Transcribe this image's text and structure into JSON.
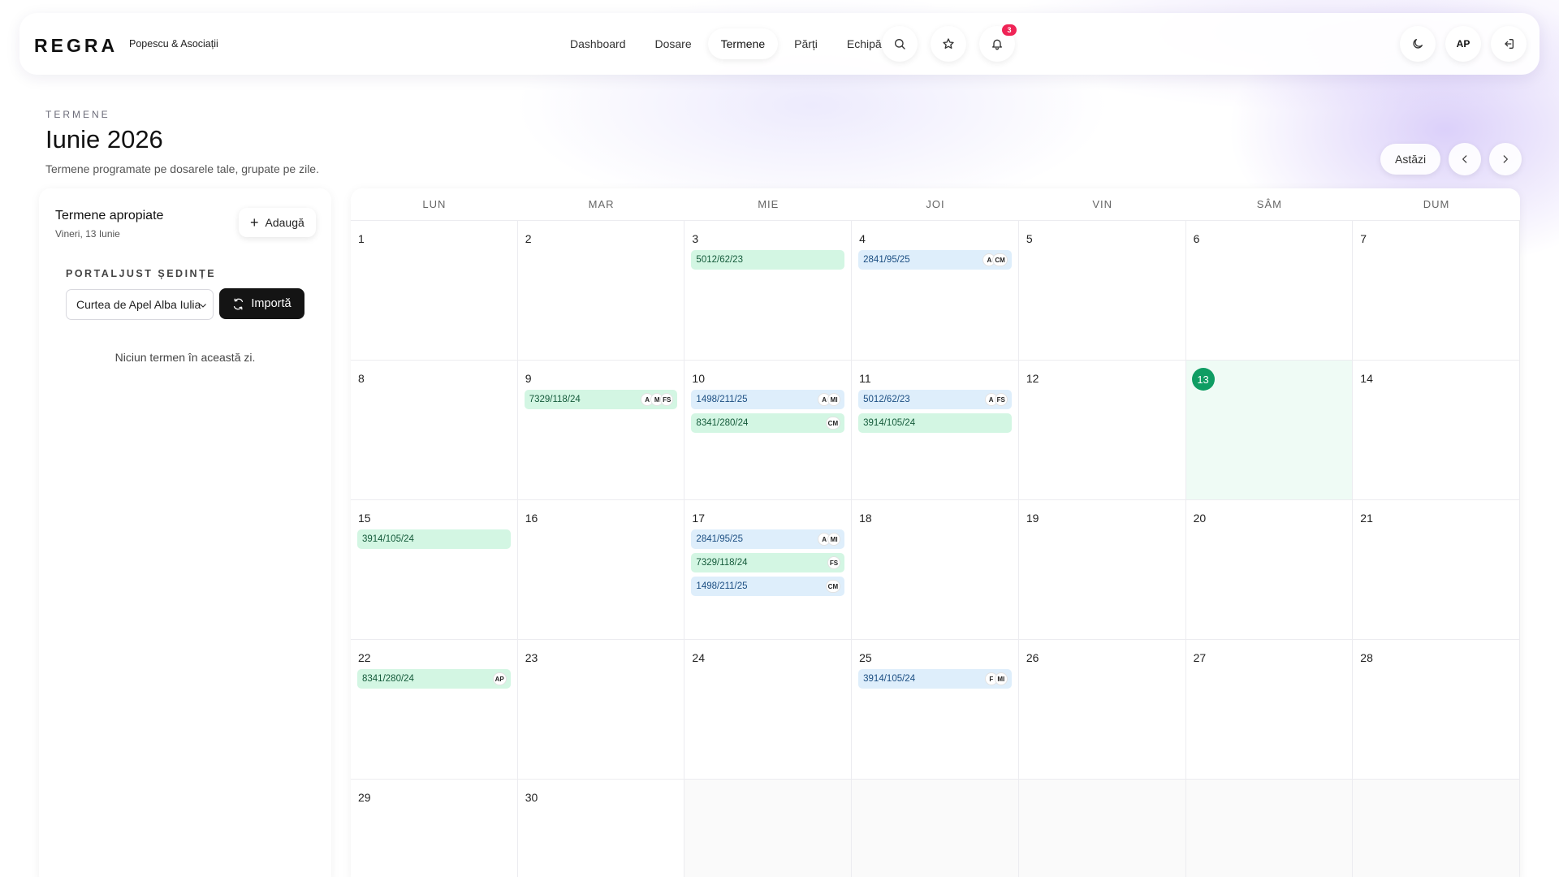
{
  "brand": {
    "logo": "REGRA",
    "firm": "Popescu & Asociații"
  },
  "nav": {
    "items": [
      {
        "label": "Dashboard",
        "active": false
      },
      {
        "label": "Dosare",
        "active": false
      },
      {
        "label": "Termene",
        "active": true
      },
      {
        "label": "Părți",
        "active": false
      },
      {
        "label": "Echipă",
        "active": false
      }
    ],
    "notifications_count": "3",
    "user_initials": "AP"
  },
  "header": {
    "eyebrow": "TERMENE",
    "title": "Iunie 2026",
    "subtitle": "Termene programate pe dosarele tale, grupate pe zile."
  },
  "controls": {
    "today_label": "Astăzi"
  },
  "side": {
    "title": "Termene apropiate",
    "date": "Vineri, 13 Iunie",
    "add_label": "Adaugă",
    "portal_label": "PORTALJUST ȘEDINȚE",
    "court_selected": "Curtea de Apel Alba Iulia",
    "import_label": "Importă",
    "empty_message": "Niciun termen în această zi."
  },
  "calendar": {
    "weekdays": [
      "LUN",
      "MAR",
      "MIE",
      "JOI",
      "VIN",
      "SÂM",
      "DUM"
    ],
    "today": 13,
    "weeks": [
      [
        {
          "day": "1",
          "events": []
        },
        {
          "day": "2",
          "events": []
        },
        {
          "day": "3",
          "events": [
            {
              "case": "5012/62/23",
              "color": "green",
              "avatars": []
            }
          ]
        },
        {
          "day": "4",
          "events": [
            {
              "case": "2841/95/25",
              "color": "blue",
              "avatars": [
                "A",
                "CM"
              ]
            }
          ]
        },
        {
          "day": "5",
          "events": []
        },
        {
          "day": "6",
          "events": []
        },
        {
          "day": "7",
          "events": []
        }
      ],
      [
        {
          "day": "8",
          "events": []
        },
        {
          "day": "9",
          "events": [
            {
              "case": "7329/118/24",
              "color": "green",
              "avatars": [
                "A",
                "M",
                "FS"
              ]
            }
          ]
        },
        {
          "day": "10",
          "events": [
            {
              "case": "1498/211/25",
              "color": "blue",
              "avatars": [
                "A",
                "MI"
              ]
            },
            {
              "case": "8341/280/24",
              "color": "green",
              "avatars": [
                "CM"
              ]
            }
          ]
        },
        {
          "day": "11",
          "events": [
            {
              "case": "5012/62/23",
              "color": "blue",
              "avatars": [
                "A",
                "FS"
              ]
            },
            {
              "case": "3914/105/24",
              "color": "green",
              "avatars": []
            }
          ]
        },
        {
          "day": "12",
          "events": []
        },
        {
          "day": "13",
          "events": []
        },
        {
          "day": "14",
          "events": []
        }
      ],
      [
        {
          "day": "15",
          "events": [
            {
              "case": "3914/105/24",
              "color": "green",
              "avatars": []
            }
          ]
        },
        {
          "day": "16",
          "events": []
        },
        {
          "day": "17",
          "events": [
            {
              "case": "2841/95/25",
              "color": "blue",
              "avatars": [
                "A",
                "MI"
              ]
            },
            {
              "case": "7329/118/24",
              "color": "green",
              "avatars": [
                "FS"
              ]
            },
            {
              "case": "1498/211/25",
              "color": "blue",
              "avatars": [
                "CM"
              ]
            }
          ]
        },
        {
          "day": "18",
          "events": []
        },
        {
          "day": "19",
          "events": []
        },
        {
          "day": "20",
          "events": []
        },
        {
          "day": "21",
          "events": []
        }
      ],
      [
        {
          "day": "22",
          "events": [
            {
              "case": "8341/280/24",
              "color": "green",
              "avatars": [
                "AP"
              ]
            }
          ]
        },
        {
          "day": "23",
          "events": []
        },
        {
          "day": "24",
          "events": []
        },
        {
          "day": "25",
          "events": [
            {
              "case": "3914/105/24",
              "color": "blue",
              "avatars": [
                "F",
                "MI"
              ]
            }
          ]
        },
        {
          "day": "26",
          "events": []
        },
        {
          "day": "27",
          "events": []
        },
        {
          "day": "28",
          "events": []
        }
      ],
      [
        {
          "day": "29",
          "events": []
        },
        {
          "day": "30",
          "events": []
        },
        {
          "day": "",
          "events": []
        },
        {
          "day": "",
          "events": []
        },
        {
          "day": "",
          "events": []
        },
        {
          "day": "",
          "events": []
        },
        {
          "day": "",
          "events": []
        }
      ]
    ]
  },
  "colors": {
    "accent_today": "#0f9d63",
    "badge": "#ef2456",
    "event_green": "#d3f6e3",
    "event_blue": "#deeefb"
  },
  "icons": [
    "search-icon",
    "star-icon",
    "bell-icon",
    "moon-icon",
    "logout-icon",
    "plus-icon",
    "refresh-icon",
    "chevron-left-icon",
    "chevron-right-icon",
    "chevron-down-icon"
  ]
}
